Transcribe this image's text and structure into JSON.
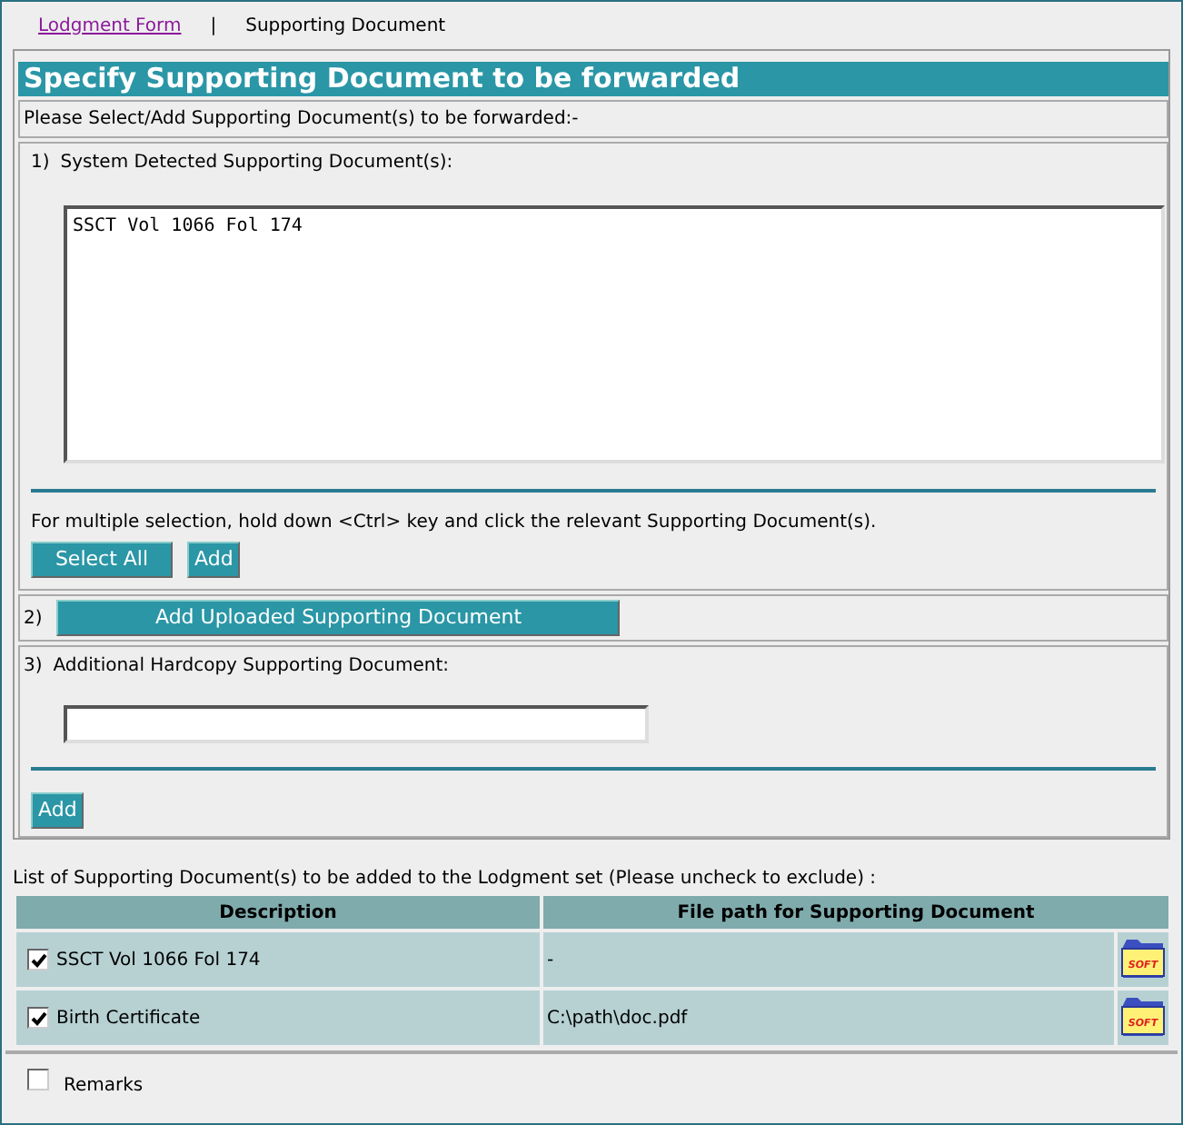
{
  "tabs": [
    {
      "label": "Lodgment Form",
      "selected": false
    },
    {
      "label": "|",
      "kind": "separator"
    },
    {
      "label": "Supporting Document",
      "selected": true
    }
  ],
  "heading": "Specify Supporting Document to be forwarded",
  "instruction": "Please Select/Add Supporting Document(s) to be forwarded:-",
  "section_1": {
    "number": "1)",
    "label": "System Detected Supporting Document(s):",
    "list_items": [
      {
        "label": "SSCT Vol 1066 Fol 174",
        "selected": false
      }
    ],
    "hint": "For multiple selection, hold down <Ctrl> key and click the relevant Supporting Document(s).",
    "buttons": [
      "Select All",
      "Add"
    ]
  },
  "section_2": {
    "number": "2)",
    "button": "Add Uploaded Supporting Document"
  },
  "section_3": {
    "number": "3)",
    "label": "Additional Hardcopy Supporting Document:",
    "button": "Add"
  },
  "table": {
    "caption": "List of Supporting Document(s) to be added to the Lodgment set (Please uncheck to exclude) :",
    "columns": [
      "Description",
      "File path for Supporting Document"
    ],
    "rows": [
      {
        "checked": true,
        "description": "SSCT Vol 1066 Fol 174",
        "file_path": "-",
        "icon_label": "SOFT"
      },
      {
        "checked": true,
        "description": "Birth Certificate",
        "file_path": "C:\\path\\doc.pdf",
        "icon_label": "SOFT"
      }
    ]
  },
  "remarks": {
    "label": "Remarks",
    "checked": false
  }
}
